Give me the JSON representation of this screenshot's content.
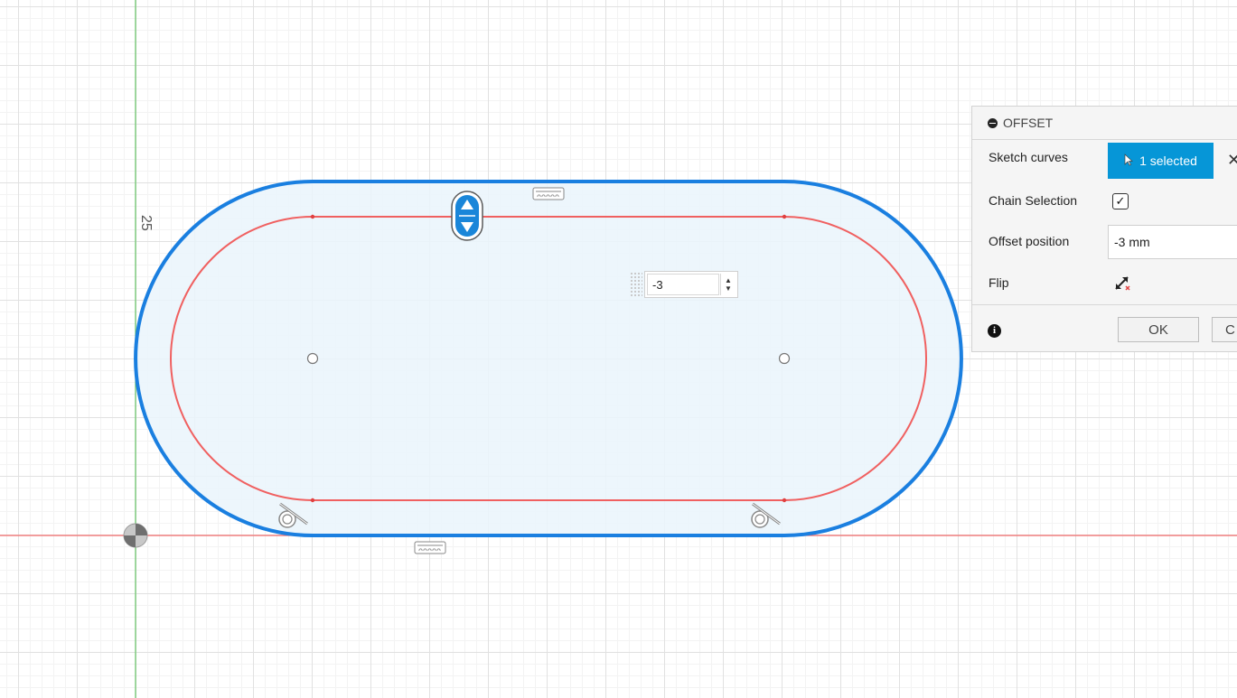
{
  "canvas": {
    "dimension_label": "25",
    "offset_value_input": "-3"
  },
  "dialog": {
    "title": "OFFSET",
    "sketch_curves": {
      "label": "Sketch curves",
      "selection": "1 selected"
    },
    "chain_selection": {
      "label": "Chain Selection",
      "checked": true
    },
    "offset_position": {
      "label": "Offset position",
      "value": "-3 mm"
    },
    "flip": {
      "label": "Flip"
    },
    "buttons": {
      "ok": "OK",
      "cancel": "C"
    }
  },
  "icons": {
    "selection_cursor": "cursor-arrow-icon",
    "clear_selection": "close-icon",
    "info": "info-icon",
    "flip": "flip-arrows-icon",
    "collapse": "collapse-icon"
  },
  "colors": {
    "sketch_profile": "#1a7fe0",
    "offset_curve": "#f06060",
    "profile_fill": "#eaf4fb",
    "selection_button": "#0696d7",
    "x_axis": "#f26b6b",
    "y_axis": "#66c466"
  }
}
